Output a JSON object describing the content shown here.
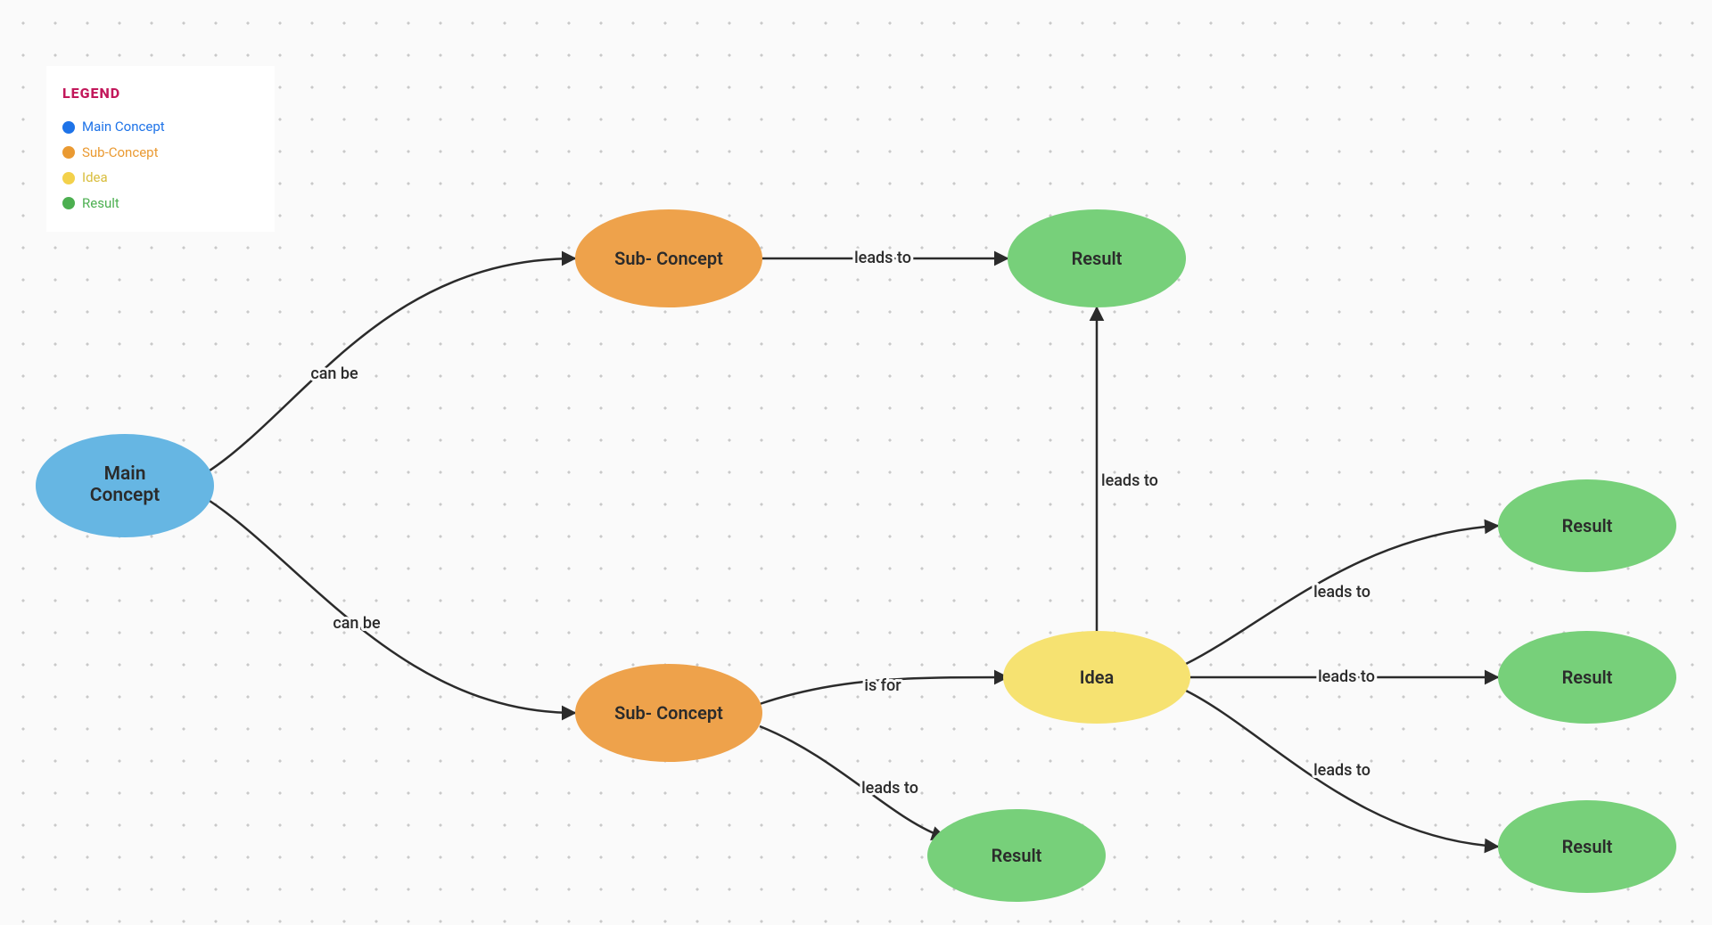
{
  "legend": {
    "title": "LEGEND",
    "items": [
      {
        "label": "Main Concept",
        "colorClass": "blue"
      },
      {
        "label": "Sub-Concept",
        "colorClass": "orange"
      },
      {
        "label": "Idea",
        "colorClass": "yellow"
      },
      {
        "label": "Result",
        "colorClass": "green"
      }
    ]
  },
  "colors": {
    "main": "#66b6e3",
    "sub": "#eea24b",
    "idea": "#f6e271",
    "result": "#77d07a",
    "stroke": "#2b2b2b"
  },
  "nodes": {
    "main": {
      "label": "Main Concept",
      "line1": "Main",
      "line2": "Concept"
    },
    "sub1": {
      "label": "Sub- Concept"
    },
    "sub2": {
      "label": "Sub- Concept"
    },
    "idea": {
      "label": "Idea"
    },
    "result_top": {
      "label": "Result"
    },
    "result_bot": {
      "label": "Result"
    },
    "result_r1": {
      "label": "Result"
    },
    "result_r2": {
      "label": "Result"
    },
    "result_r3": {
      "label": "Result"
    }
  },
  "edges": {
    "canbe1": "can be",
    "canbe2": "can be",
    "leads_top": "leads to",
    "isfor": "is for",
    "leads_bot": "leads to",
    "leads_up": "leads to",
    "leads_r1": "leads to",
    "leads_r2": "leads to",
    "leads_r3": "leads to"
  }
}
